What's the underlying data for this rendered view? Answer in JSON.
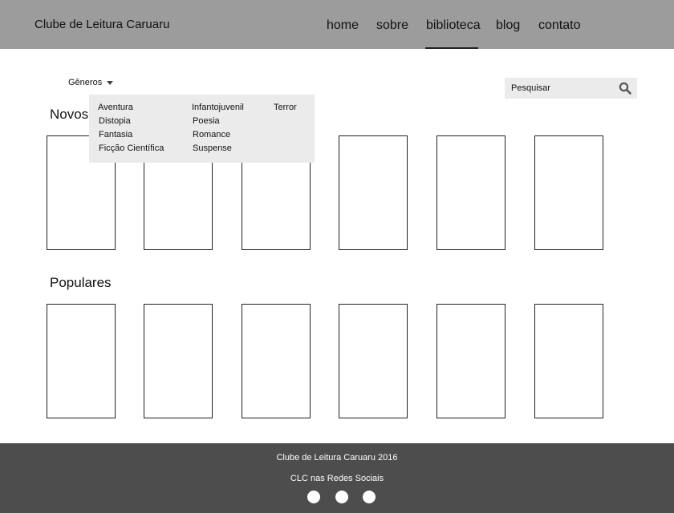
{
  "header": {
    "brand": "Clube de Leitura Caruaru",
    "nav": [
      {
        "label": "home"
      },
      {
        "label": "sobre"
      },
      {
        "label": "biblioteca",
        "active": true
      },
      {
        "label": "blog"
      },
      {
        "label": "contato"
      }
    ]
  },
  "filters": {
    "genres_label": "Gêneros",
    "search_placeholder": "Pesquisar"
  },
  "genres_menu": {
    "col1": [
      "Aventura",
      "Distopia",
      "Fantasia",
      "Ficção Científica"
    ],
    "col2": [
      "Infantojuvenil",
      "Poesia",
      "Romance",
      "Suspense"
    ],
    "col3": [
      "Terror"
    ]
  },
  "sections": {
    "novos": "Novos",
    "populares": "Populares"
  },
  "footer": {
    "copyright": "Clube de Leitura Caruaru 2016",
    "social_label": "CLC nas Redes Sociais"
  },
  "icons": {
    "search": "search-icon",
    "dropdown": "chevron-down-icon",
    "social": "social-icon"
  },
  "colors": {
    "header_bg": "#9c9c9c",
    "footer_bg": "#4d4d4d",
    "panel_bg": "#ebebeb"
  }
}
